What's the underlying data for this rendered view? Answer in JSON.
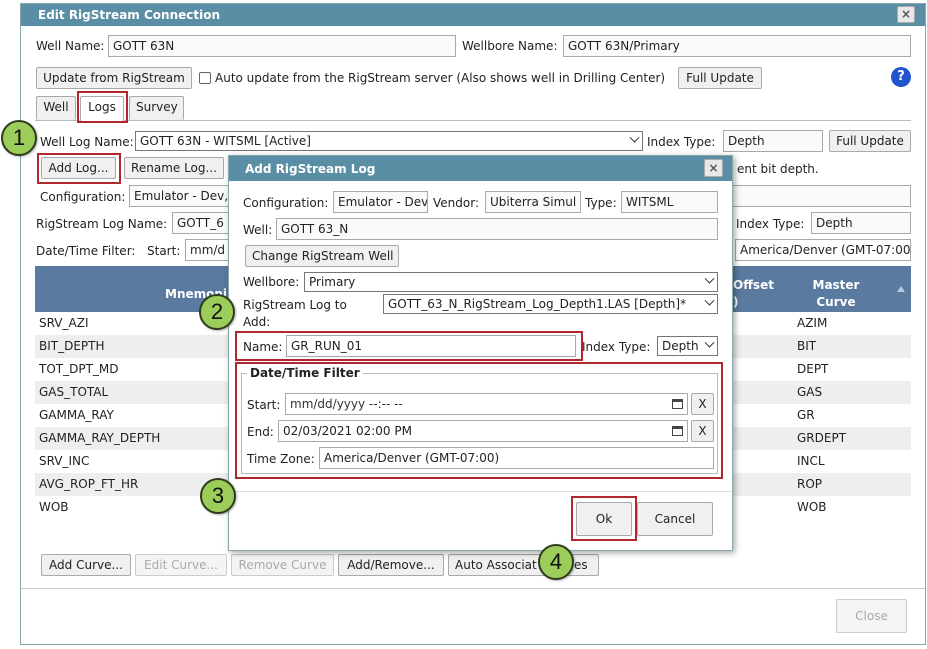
{
  "main_dialog": {
    "title": "Edit RigStream Connection",
    "well_name_label": "Well Name:",
    "well_name_value": "GOTT 63N",
    "wellbore_name_label": "Wellbore Name:",
    "wellbore_name_value": "GOTT 63N/Primary",
    "update_button": "Update from RigStream",
    "auto_update_label": "Auto update from the RigStream server (Also shows well in Drilling Center)",
    "full_update_button": "Full Update",
    "help_icon_text": "?",
    "tabs": [
      {
        "label": "Well"
      },
      {
        "label": "Logs"
      },
      {
        "label": "Survey"
      }
    ],
    "well_log_name_label": "Well Log Name:",
    "well_log_name_value": "GOTT 63N - WITSML [Active]",
    "index_type_label": "Index Type:",
    "index_type_value": "Depth",
    "full_update_button_2": "Full Update",
    "add_log_button": "Add Log...",
    "rename_log_button": "Rename Log...",
    "bit_depth_note": "ent bit depth.",
    "configuration_label": "Configuration:",
    "configuration_value": "Emulator - Dev,",
    "rigstream_log_name_label": "RigStream Log Name:",
    "rigstream_log_name_value": "GOTT_6",
    "index_type_label_2": "Index Type:",
    "index_type_value_2": "Depth",
    "datetime_filter_label": "Date/Time Filter:",
    "start_label": "Start:",
    "start_value": "mm/d",
    "timezone_value": "America/Denver (GMT-07:00",
    "table": {
      "col_mnemonic": "Mnemoni",
      "col_offset": "Offset",
      "col_offset_2": ")",
      "col_master_curve": "Master Curve",
      "rows": [
        {
          "mnemonic": "SRV_AZI",
          "master": "AZIM"
        },
        {
          "mnemonic": "BIT_DEPTH",
          "master": "BIT"
        },
        {
          "mnemonic": "TOT_DPT_MD",
          "master": "DEPT"
        },
        {
          "mnemonic": "GAS_TOTAL",
          "master": "GAS"
        },
        {
          "mnemonic": "GAMMA_RAY",
          "master": "GR"
        },
        {
          "mnemonic": "GAMMA_RAY_DEPTH",
          "master": "GRDEPT"
        },
        {
          "mnemonic": "SRV_INC",
          "master": "INCL"
        },
        {
          "mnemonic": "AVG_ROP_FT_HR",
          "master": "ROP"
        },
        {
          "mnemonic": "WOB",
          "master": "WOB"
        }
      ]
    },
    "add_curve_button": "Add Curve...",
    "edit_curve_button": "Edit Curve...",
    "remove_curve_button": "Remove Curve",
    "add_remove_button": "Add/Remove...",
    "auto_associate_button": "Auto Associat",
    "auto_associate_tail": "es",
    "close_button": "Close"
  },
  "add_log_dialog": {
    "title": "Add RigStream Log",
    "configuration_label": "Configuration:",
    "configuration_value": "Emulator - Dev",
    "vendor_label": "Vendor:",
    "vendor_value": "Ubiterra Simul",
    "type_label": "Type:",
    "type_value": "WITSML",
    "well_label": "Well:",
    "well_value": "GOTT 63_N",
    "change_well_button": "Change RigStream Well",
    "wellbore_label": "Wellbore:",
    "wellbore_value": "Primary",
    "log_to_add_label_1": "RigStream Log to",
    "log_to_add_label_2": "Add:",
    "log_to_add_value": "GOTT_63_N_RigStream_Log_Depth1.LAS [Depth]*",
    "name_label": "Name:",
    "name_value": "GR_RUN_01",
    "index_type_label": "Index Type:",
    "index_type_value": "Depth",
    "filter_legend": "Date/Time Filter",
    "start_label": "Start:",
    "start_placeholder": "mm/dd/yyyy --:-- --",
    "end_label": "End:",
    "end_value": "02/03/2021 02:00 PM",
    "clear_label": "X",
    "timezone_label": "Time Zone:",
    "timezone_value": "America/Denver (GMT-07:00)",
    "ok_button": "Ok",
    "cancel_button": "Cancel"
  },
  "callouts": [
    "1",
    "2",
    "3",
    "4"
  ],
  "colors": {
    "title_bar": "#5a8ea4",
    "table_header": "#5a7aa0",
    "callout_fill": "#9ccc5a",
    "highlight_red": "#b0282e",
    "help_blue": "#2255cc"
  }
}
